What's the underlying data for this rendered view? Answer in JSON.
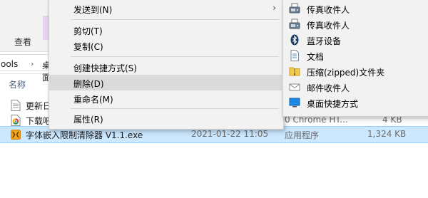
{
  "ribbon": {
    "tab_view": "查看"
  },
  "address": {
    "path_fragment": "ools",
    "separator": "›",
    "current": "桌面"
  },
  "columns": {
    "name": "名称"
  },
  "files": [
    {
      "name": "更新日",
      "date": "",
      "type": "",
      "size": ""
    },
    {
      "name": "下载吧",
      "date": "",
      "type": "0 Chrome HT...",
      "size": "4 KB"
    },
    {
      "name": "字体嵌入限制清除器 V1.1.exe",
      "date": "2021-01-22 11:05",
      "type": "应用程序",
      "size": "1,324 KB"
    }
  ],
  "context_menu": {
    "send_to": "发送到(N)",
    "cut": "剪切(T)",
    "copy": "复制(C)",
    "create_shortcut": "创建快捷方式(S)",
    "delete": "删除(D)",
    "rename": "重命名(M)",
    "properties": "属性(R)",
    "submenu_arrow": "›"
  },
  "send_to_menu": {
    "items": [
      {
        "label": "传真收件人",
        "icon": "fax-icon"
      },
      {
        "label": "传真收件人",
        "icon": "fax-icon"
      },
      {
        "label": "蓝牙设备",
        "icon": "bluetooth-icon"
      },
      {
        "label": "文档",
        "icon": "documents-icon"
      },
      {
        "label": "压缩(zipped)文件夹",
        "icon": "zip-folder-icon"
      },
      {
        "label": "邮件收件人",
        "icon": "mail-icon"
      },
      {
        "label": "桌面快捷方式",
        "icon": "desktop-icon"
      }
    ]
  }
}
